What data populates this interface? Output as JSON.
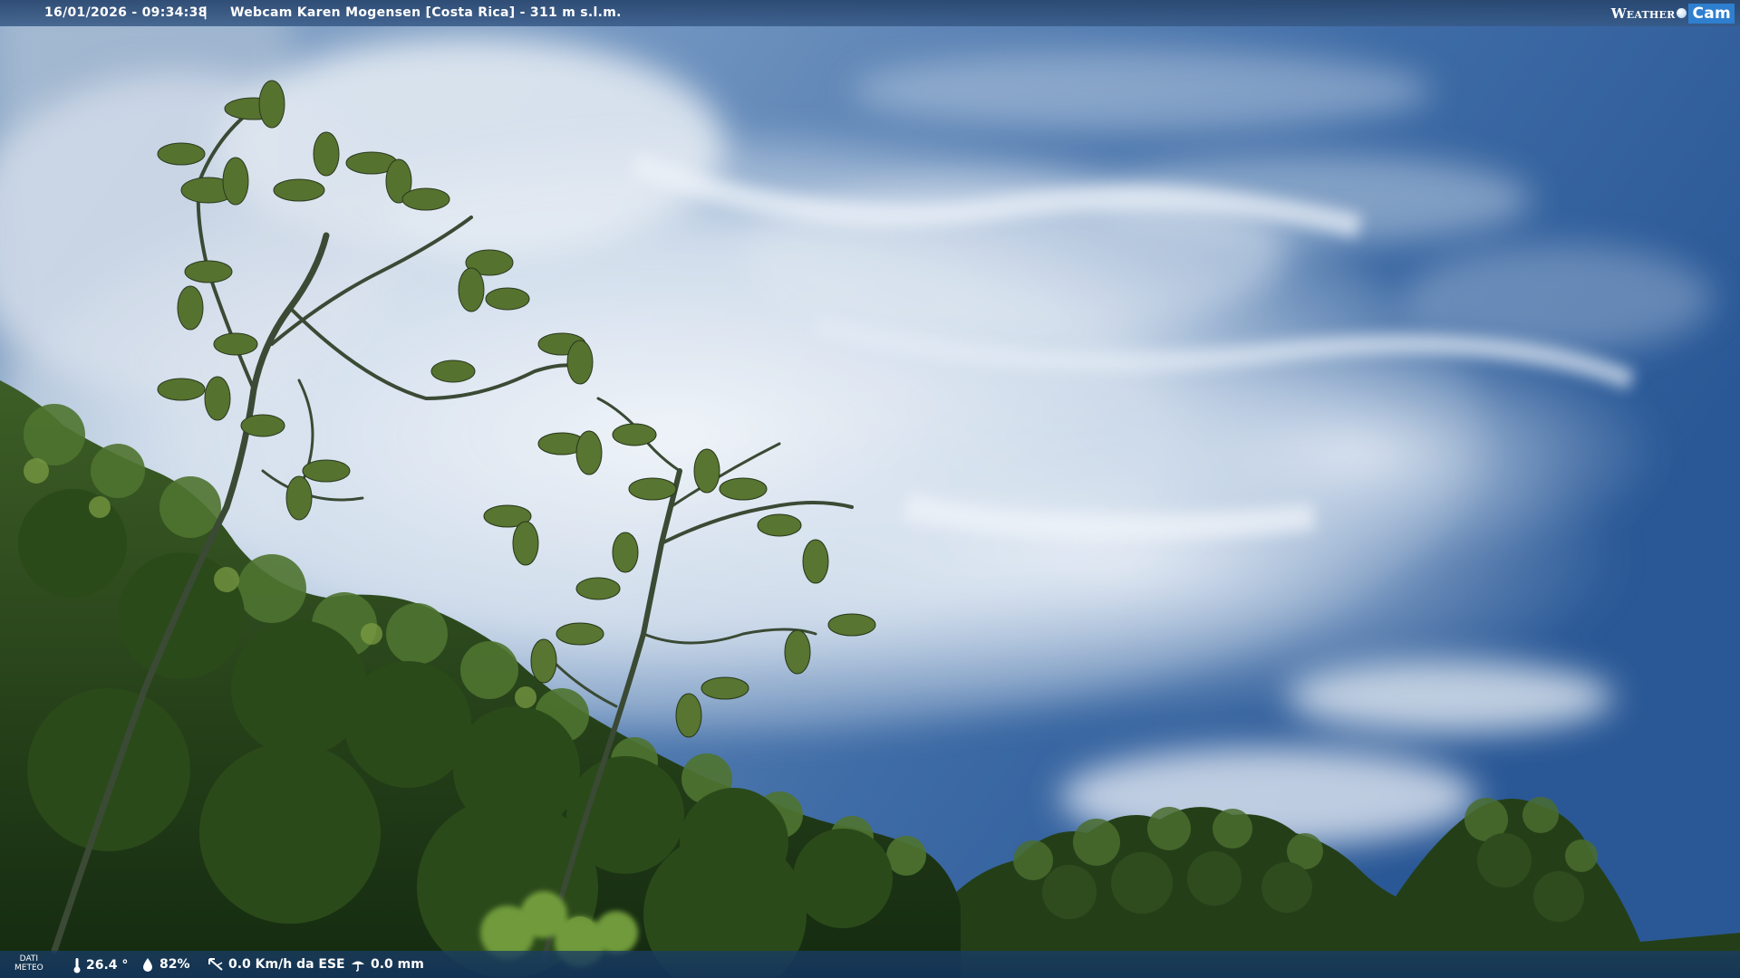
{
  "overlay": {
    "timestamp": "16/01/2026 - 09:34:38",
    "separator": "|",
    "title": "Webcam Karen Mogensen [Costa Rica] - 311 m s.l.m.",
    "logo": {
      "word": "Weather",
      "cam": "Cam"
    }
  },
  "weather": {
    "label_line1": "DATI",
    "label_line2": "METEO",
    "temperature": "26.4 °",
    "humidity": "82%",
    "wind": "0.0 Km/h da ESE",
    "rain": "0.0 mm"
  },
  "icons": {
    "temperature": "thermometer-icon",
    "humidity": "water-drop-icon",
    "wind": "wind-vane-icon",
    "rain": "rain-gauge-icon"
  },
  "colors": {
    "sky_top": "#2f5f9c",
    "sky_right": "#2c5b98",
    "cloud": "#e8eef5",
    "foliage_dark": "#1d3614",
    "foliage_light": "#6d8f3a",
    "bar": "#274a78"
  }
}
